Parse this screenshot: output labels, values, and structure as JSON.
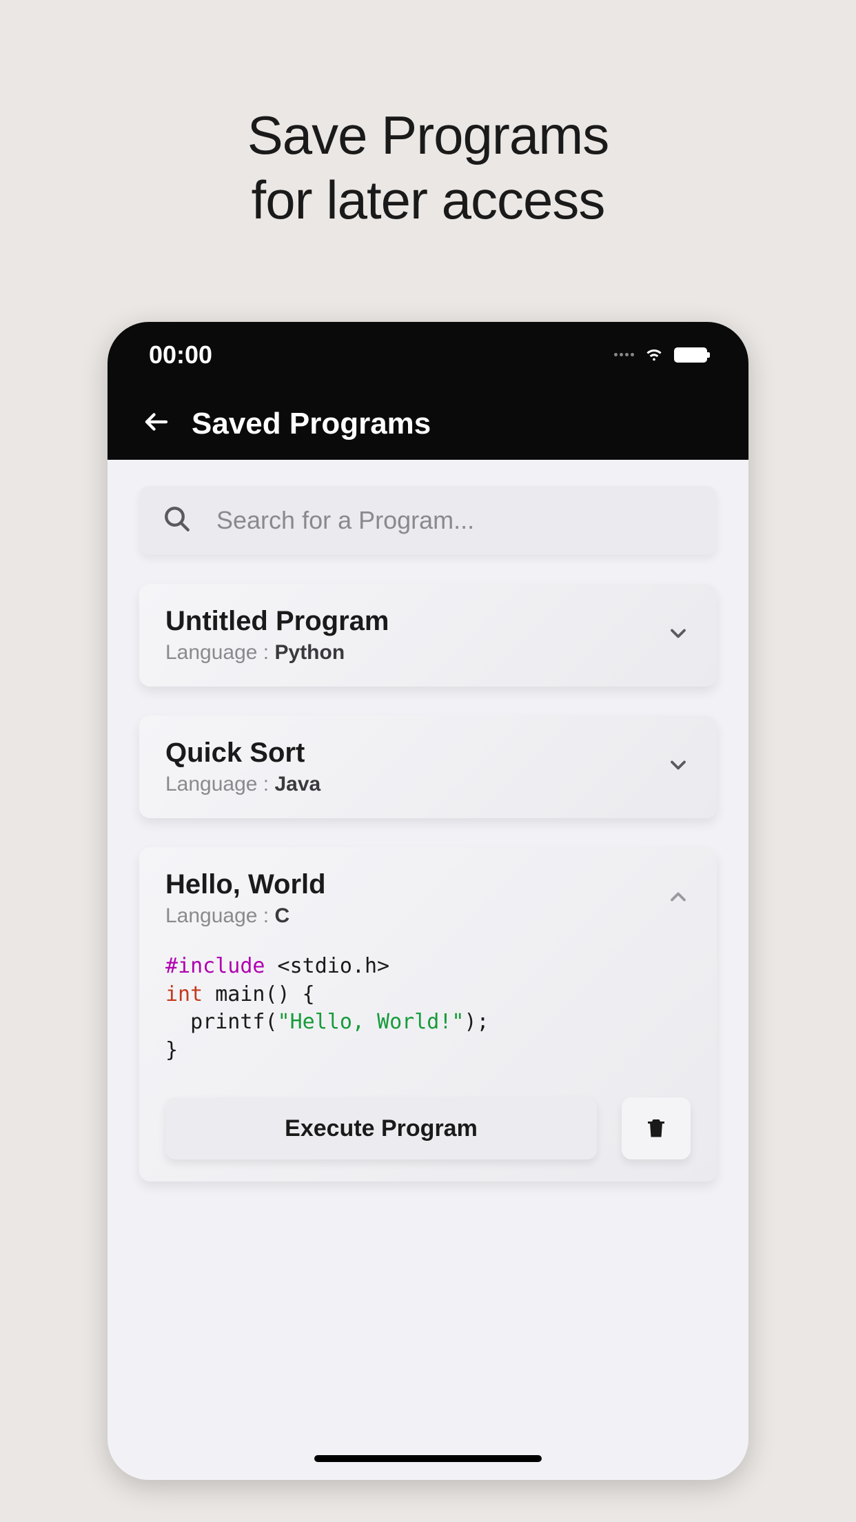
{
  "promo": {
    "line1": "Save Programs",
    "line2": "for later access"
  },
  "status": {
    "time": "00:00"
  },
  "appbar": {
    "title": "Saved Programs"
  },
  "search": {
    "placeholder": "Search for a Program..."
  },
  "language_label": "Language :",
  "programs": [
    {
      "title": "Untitled Program",
      "language": "Python",
      "expanded": false
    },
    {
      "title": "Quick Sort",
      "language": "Java",
      "expanded": false
    },
    {
      "title": "Hello, World",
      "language": "C",
      "expanded": true
    }
  ],
  "code_tokens": [
    {
      "t": "#",
      "c": "tok-hash"
    },
    {
      "t": "include",
      "c": "tok-keyword"
    },
    {
      "t": " <stdio.h>\n",
      "c": "tok-include"
    },
    {
      "t": "int",
      "c": "tok-type"
    },
    {
      "t": " main() {\n  printf(",
      "c": ""
    },
    {
      "t": "\"Hello, World!\"",
      "c": "tok-string"
    },
    {
      "t": ");\n}",
      "c": ""
    }
  ],
  "actions": {
    "execute": "Execute Program"
  }
}
